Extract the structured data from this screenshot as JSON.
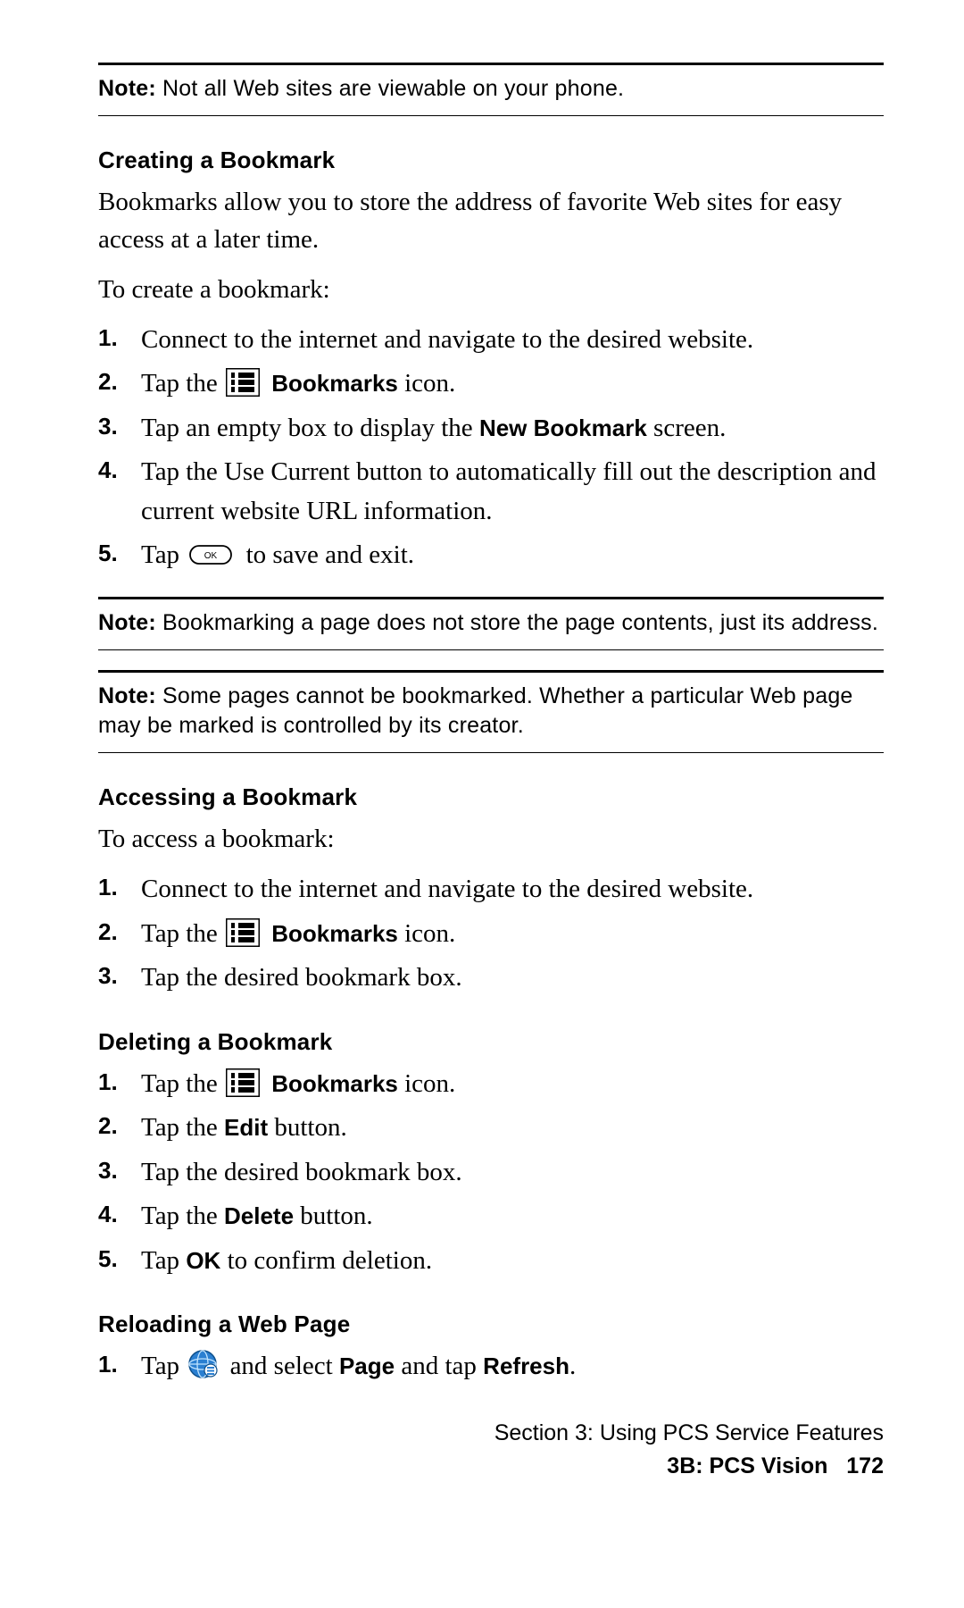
{
  "notes": {
    "n1_label": "Note:",
    "n1_text": " Not all Web sites are viewable on your phone.",
    "n2_label": "Note:",
    "n2_text": " Bookmarking a page does not store the page contents, just its address.",
    "n3_label": "Note:",
    "n3_text": " Some pages cannot be bookmarked. Whether a particular Web page may be marked is controlled by its creator."
  },
  "sec_creating": {
    "head": "Creating a Bookmark",
    "intro": "Bookmarks allow you to store the address of favorite Web sites for easy access at a later time.",
    "lead": "To create a bookmark:",
    "s1_num": "1.",
    "s1": "Connect to the internet and navigate to the desired website.",
    "s2_num": "2.",
    "s2a": "Tap the ",
    "s2_icon_label": "Bookmarks",
    "s2b": " icon.",
    "s3_num": "3.",
    "s3a": "Tap an empty box to display the ",
    "s3_bold": "New Bookmark",
    "s3b": " screen.",
    "s4_num": "4.",
    "s4": "Tap the Use Current button to automatically fill out the description and current website URL information.",
    "s5_num": "5.",
    "s5a": "Tap ",
    "s5b": " to save and exit."
  },
  "sec_accessing": {
    "head": "Accessing a Bookmark",
    "lead": "To access a bookmark:",
    "s1_num": "1.",
    "s1": "Connect to the internet and navigate to the desired website.",
    "s2_num": "2.",
    "s2a": "Tap the ",
    "s2_icon_label": "Bookmarks",
    "s2b": " icon.",
    "s3_num": "3.",
    "s3": "Tap the desired bookmark box."
  },
  "sec_deleting": {
    "head": "Deleting a Bookmark",
    "s1_num": "1.",
    "s1a": "Tap the ",
    "s1_icon_label": "Bookmarks",
    "s1b": " icon.",
    "s2_num": "2.",
    "s2a": "Tap the ",
    "s2_bold": "Edit",
    "s2b": " button.",
    "s3_num": "3.",
    "s3": "Tap the desired bookmark box.",
    "s4_num": "4.",
    "s4a": "Tap the ",
    "s4_bold": "Delete",
    "s4b": " button.",
    "s5_num": "5.",
    "s5a": "Tap ",
    "s5_bold": "OK",
    "s5b": " to confirm deletion."
  },
  "sec_reloading": {
    "head": "Reloading a Web Page",
    "s1_num": "1.",
    "s1a": "Tap ",
    "s1b": " and select ",
    "s1_bold1": "Page",
    "s1c": " and tap ",
    "s1_bold2": "Refresh",
    "s1d": "."
  },
  "footer": {
    "line1": "Section 3: Using PCS Service Features",
    "line2a": "3B: PCS Vision",
    "pagenum": "172"
  }
}
